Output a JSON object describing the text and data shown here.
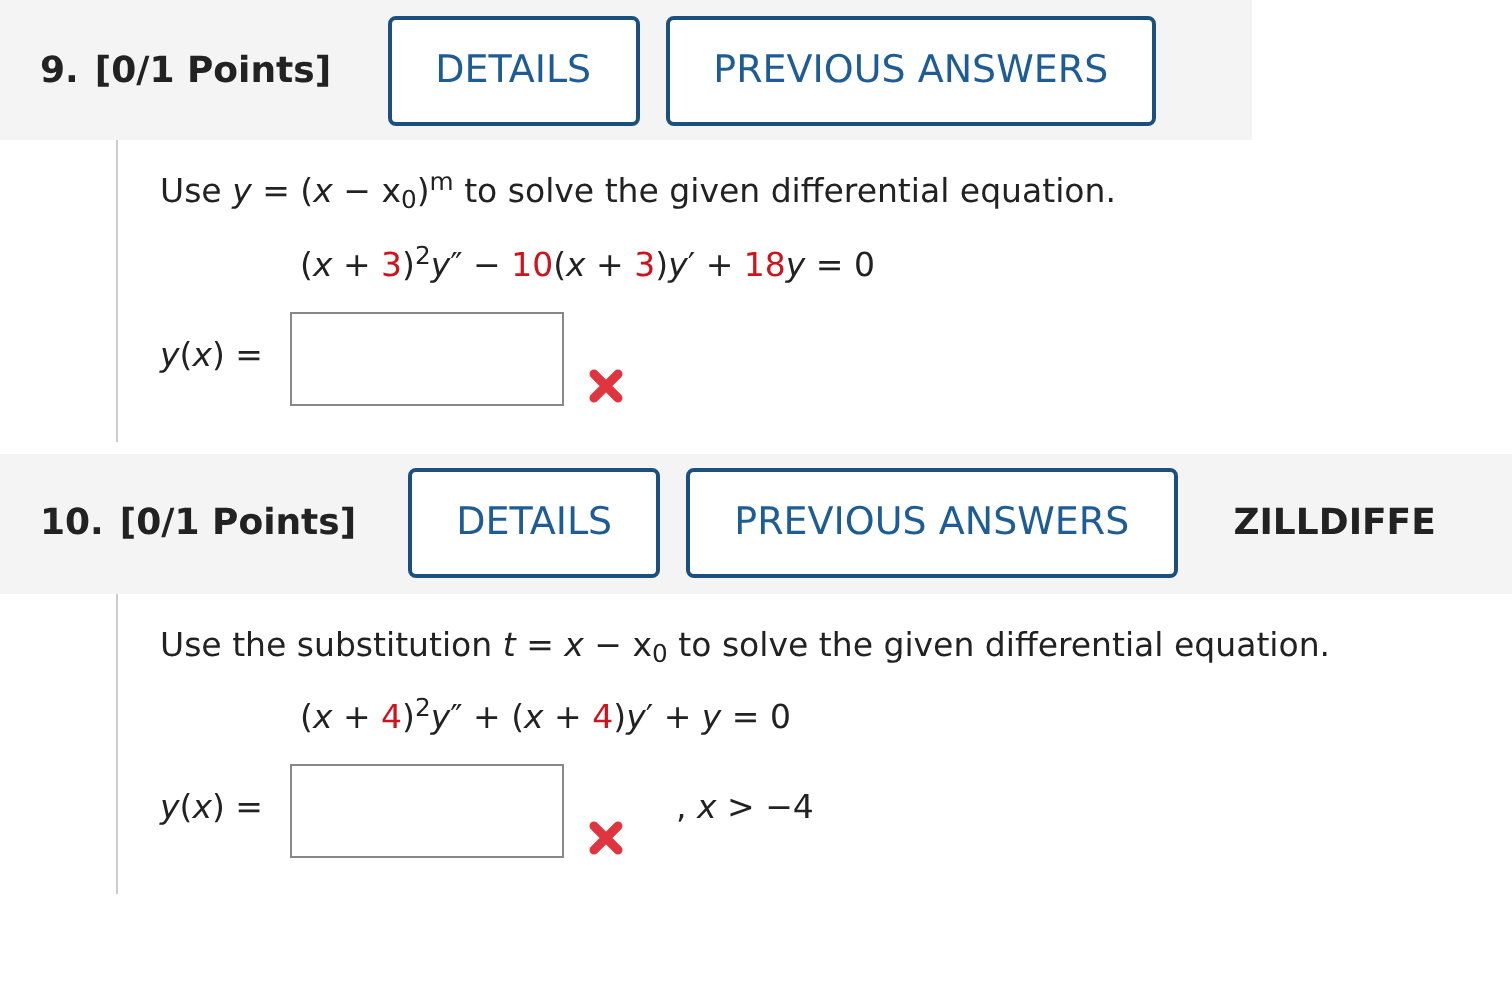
{
  "questions": [
    {
      "number": "9.",
      "points": "[0/1 Points]",
      "buttons": [
        "DETAILS",
        "PREVIOUS ANSWERS"
      ],
      "instruction": "Use *y* = (*x* − x$_{0}$)$^{m}$ to solve the given differential equation.",
      "equation": [
        {
          "kind": "plain",
          "text": "(*x* + "
        },
        {
          "kind": "param",
          "text": "3"
        },
        {
          "kind": "plain",
          "text": ")$^{2}$*y*″ − "
        },
        {
          "kind": "param",
          "text": "10"
        },
        {
          "kind": "plain",
          "text": "(*x* + "
        },
        {
          "kind": "param",
          "text": "3"
        },
        {
          "kind": "plain",
          "text": ")*y*′ + "
        },
        {
          "kind": "param",
          "text": "18"
        },
        {
          "kind": "plain",
          "text": "*y* = 0"
        }
      ],
      "answer": {
        "label": "*y*(*x*) =",
        "correct": false
      }
    },
    {
      "number": "10.",
      "points": "[0/1 Points]",
      "buttons": [
        "DETAILS",
        "PREVIOUS ANSWERS"
      ],
      "tag": "ZILLDIFFE",
      "instruction": "Use the substitution *t* = *x* − x$_{0}$ to solve the given differential equation.",
      "equation": [
        {
          "kind": "plain",
          "text": "(*x* + "
        },
        {
          "kind": "param",
          "text": "4"
        },
        {
          "kind": "plain",
          "text": ")$^{2}$*y*″ + (*x* + "
        },
        {
          "kind": "param",
          "text": "4"
        },
        {
          "kind": "plain",
          "text": ")*y*′ + *y* = 0"
        }
      ],
      "answer": {
        "label": "*y*(*x*) =",
        "correct": false,
        "condition": ", *x* > −4"
      }
    }
  ]
}
